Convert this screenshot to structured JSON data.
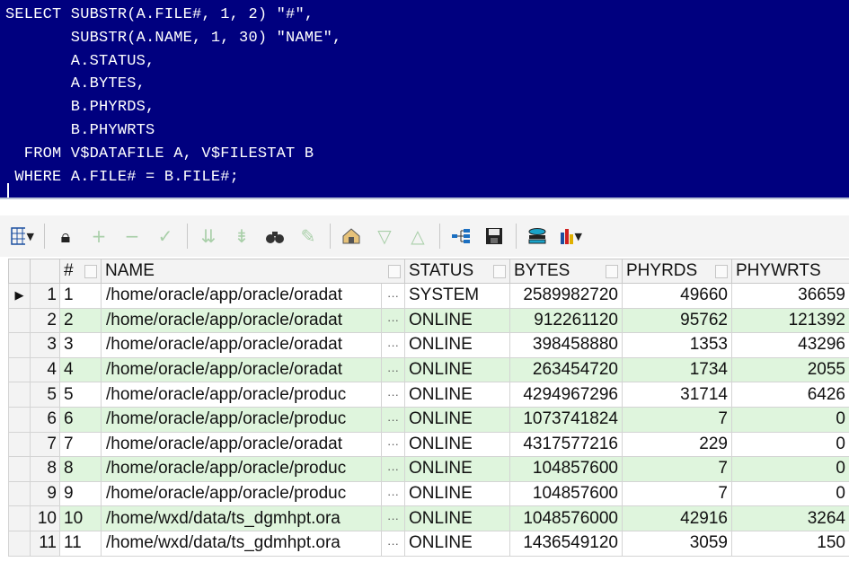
{
  "sql": {
    "lines": [
      "SELECT SUBSTR(A.FILE#, 1, 2) \"#\",",
      "       SUBSTR(A.NAME, 1, 30) \"NAME\",",
      "       A.STATUS,",
      "       A.BYTES,",
      "       B.PHYRDS,",
      "       B.PHYWRTS",
      "  FROM V$DATAFILE A, V$FILESTAT B",
      " WHERE A.FILE# = B.FILE#;"
    ]
  },
  "toolbar": {
    "icons": [
      "grid-options-icon",
      "lock-icon",
      "add-record-icon",
      "delete-record-icon",
      "post-edit-icon",
      "filter-down-icon",
      "filter-clear-icon",
      "find-icon",
      "clear-icon",
      "export-icon",
      "move-down-icon",
      "move-up-icon",
      "query-plan-icon",
      "save-icon",
      "record-view-icon",
      "chart-icon"
    ]
  },
  "grid": {
    "columns": [
      "#",
      "NAME",
      "STATUS",
      "BYTES",
      "PHYRDS",
      "PHYWRTS"
    ],
    "current_row_indicator": "▶",
    "rows": [
      {
        "rownum": "1",
        "file": "1",
        "name": "/home/oracle/app/oracle/oradat",
        "status": "SYSTEM",
        "bytes": "2589982720",
        "phyrds": "49660",
        "phywrts": "36659"
      },
      {
        "rownum": "2",
        "file": "2",
        "name": "/home/oracle/app/oracle/oradat",
        "status": "ONLINE",
        "bytes": "912261120",
        "phyrds": "95762",
        "phywrts": "121392"
      },
      {
        "rownum": "3",
        "file": "3",
        "name": "/home/oracle/app/oracle/oradat",
        "status": "ONLINE",
        "bytes": "398458880",
        "phyrds": "1353",
        "phywrts": "43296"
      },
      {
        "rownum": "4",
        "file": "4",
        "name": "/home/oracle/app/oracle/oradat",
        "status": "ONLINE",
        "bytes": "263454720",
        "phyrds": "1734",
        "phywrts": "2055"
      },
      {
        "rownum": "5",
        "file": "5",
        "name": "/home/oracle/app/oracle/produc",
        "status": "ONLINE",
        "bytes": "4294967296",
        "phyrds": "31714",
        "phywrts": "6426"
      },
      {
        "rownum": "6",
        "file": "6",
        "name": "/home/oracle/app/oracle/produc",
        "status": "ONLINE",
        "bytes": "1073741824",
        "phyrds": "7",
        "phywrts": "0"
      },
      {
        "rownum": "7",
        "file": "7",
        "name": "/home/oracle/app/oracle/oradat",
        "status": "ONLINE",
        "bytes": "4317577216",
        "phyrds": "229",
        "phywrts": "0"
      },
      {
        "rownum": "8",
        "file": "8",
        "name": "/home/oracle/app/oracle/produc",
        "status": "ONLINE",
        "bytes": "104857600",
        "phyrds": "7",
        "phywrts": "0"
      },
      {
        "rownum": "9",
        "file": "9",
        "name": "/home/oracle/app/oracle/produc",
        "status": "ONLINE",
        "bytes": "104857600",
        "phyrds": "7",
        "phywrts": "0"
      },
      {
        "rownum": "10",
        "file": "10",
        "name": "/home/wxd/data/ts_dgmhpt.ora",
        "status": "ONLINE",
        "bytes": "1048576000",
        "phyrds": "42916",
        "phywrts": "3264"
      },
      {
        "rownum": "11",
        "file": "11",
        "name": "/home/wxd/data/ts_gdmhpt.ora",
        "status": "ONLINE",
        "bytes": "1436549120",
        "phyrds": "3059",
        "phywrts": "150"
      }
    ]
  },
  "colors": {
    "editor_bg": "#00007f",
    "alt_row": "#dff5dd"
  }
}
